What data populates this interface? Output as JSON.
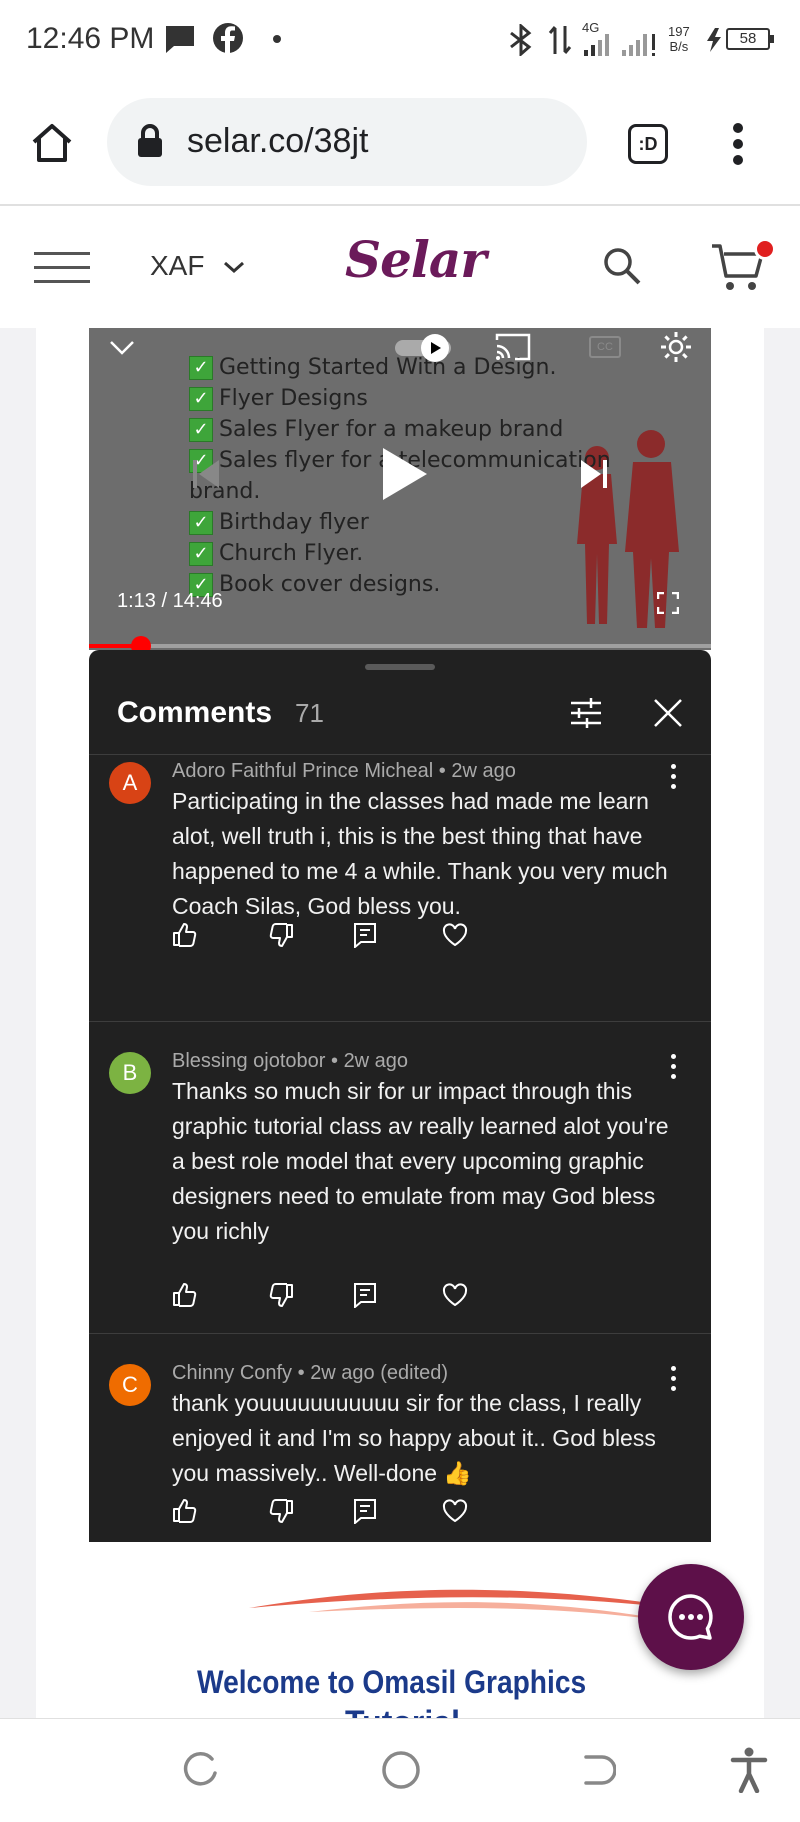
{
  "status_bar": {
    "time": "12:46 PM",
    "network": "4G",
    "speed_value": "197",
    "speed_unit": "B/s",
    "battery": "58"
  },
  "browser": {
    "url": "selar.co/38jt",
    "tabs_icon_label": ":D"
  },
  "site_header": {
    "currency": "XAF",
    "brand": "Selar",
    "brand_color": "#6b1a5a"
  },
  "video": {
    "slide_lines": [
      "Getting Started With a Design.",
      "Flyer Designs",
      "Sales Flyer for a makeup brand",
      "Sales flyer for a telecommunication",
      "brand.",
      "Birthday flyer",
      "Church Flyer.",
      "Book cover designs."
    ],
    "time_display": "1:13 / 14:46",
    "progress_fraction": 0.083
  },
  "comments_panel": {
    "title": "Comments",
    "count": "71",
    "items": [
      {
        "avatar_letter": "A",
        "avatar_color": "#d84315",
        "author": "Adoro Faithful Prince Micheal",
        "time": "2w ago",
        "text": "Participating in the classes had made me learn alot, well truth i, this is the best thing that have happened to me 4 a while. Thank you very much Coach Silas, God bless you."
      },
      {
        "avatar_letter": "B",
        "avatar_color": "#7cb342",
        "author": "Blessing ojotobor",
        "time": "2w ago",
        "text": "Thanks so much sir for ur impact through this graphic tutorial class av really learned alot you're a best role model that every upcoming graphic designers need to emulate from may God bless you richly"
      },
      {
        "avatar_letter": "C",
        "avatar_color": "#ef6c00",
        "author": "Chinny Confy",
        "time": "2w ago (edited)",
        "text": "thank youuuuuuuuuuu sir for the class, I really enjoyed it and I'm so happy about it.. God bless you massively.. Well-done 👍"
      }
    ]
  },
  "banner": {
    "title": "Welcome to Omasil Graphics",
    "subtitle": "Tutorial"
  },
  "colors": {
    "comments_bg": "#212121",
    "progress_red": "#ff0000",
    "fab_purple": "#5d1049"
  }
}
